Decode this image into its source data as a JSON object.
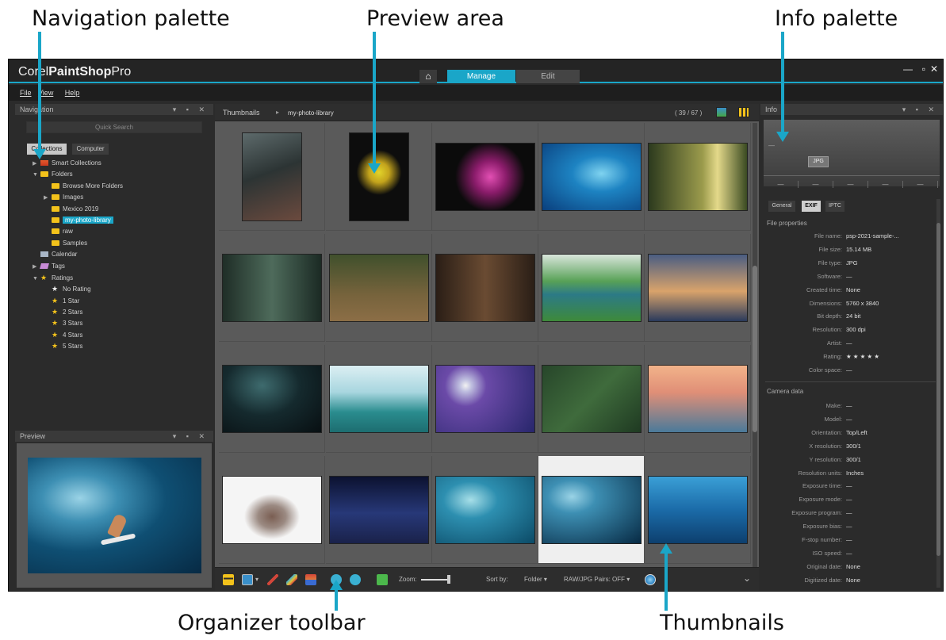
{
  "callouts": {
    "navigation": "Navigation palette",
    "preview_area": "Preview area",
    "info": "Info palette",
    "toolbar": "Organizer toolbar",
    "thumbnails": "Thumbnails"
  },
  "app": {
    "brand": "Corel",
    "product": "PaintShop",
    "suffix": "Pro",
    "home_glyph": "⌂",
    "tabs": {
      "manage": "Manage",
      "edit": "Edit"
    },
    "window_controls": [
      "—",
      "▫",
      "✕"
    ]
  },
  "menu": [
    "File",
    "View",
    "Help"
  ],
  "navigation": {
    "title": "Navigation",
    "quick_search_placeholder": "Quick Search",
    "tabs": {
      "collections": "Collections",
      "computer": "Computer"
    },
    "tree": [
      {
        "label": "Smart Collections",
        "depth": 0,
        "expander": "▶",
        "icon": "smart"
      },
      {
        "label": "Folders",
        "depth": 0,
        "expander": "▼",
        "icon": "folder"
      },
      {
        "label": "Browse More Folders",
        "depth": 1,
        "expander": "",
        "icon": "folder"
      },
      {
        "label": "Images",
        "depth": 1,
        "expander": "▶",
        "icon": "folder"
      },
      {
        "label": "Mexico 2019",
        "depth": 1,
        "expander": "",
        "icon": "folder"
      },
      {
        "label": "my-photo-library",
        "depth": 1,
        "expander": "",
        "icon": "folder",
        "selected": true
      },
      {
        "label": "raw",
        "depth": 1,
        "expander": "",
        "icon": "folder"
      },
      {
        "label": "Samples",
        "depth": 1,
        "expander": "",
        "icon": "folder"
      },
      {
        "label": "Calendar",
        "depth": 0,
        "expander": "",
        "icon": "cal"
      },
      {
        "label": "Tags",
        "depth": 0,
        "expander": "▶",
        "icon": "tag"
      },
      {
        "label": "Ratings",
        "depth": 0,
        "expander": "▼",
        "icon": "star"
      },
      {
        "label": "No Rating",
        "depth": 1,
        "expander": "",
        "icon": "star-white"
      },
      {
        "label": "1 Star",
        "depth": 1,
        "expander": "",
        "icon": "star"
      },
      {
        "label": "2 Stars",
        "depth": 1,
        "expander": "",
        "icon": "star"
      },
      {
        "label": "3 Stars",
        "depth": 1,
        "expander": "",
        "icon": "star"
      },
      {
        "label": "4 Stars",
        "depth": 1,
        "expander": "",
        "icon": "star"
      },
      {
        "label": "5 Stars",
        "depth": 1,
        "expander": "",
        "icon": "star"
      }
    ]
  },
  "preview": {
    "title": "Preview"
  },
  "palette_controls": "▾ ▪ ✕",
  "browser": {
    "crumb_root": "Thumbnails",
    "crumb_sep": "▸",
    "crumb_folder": "my-photo-library",
    "count": "( 39 / 67 )",
    "thumbnails": [
      {
        "name": "forest-light",
        "orient": "portrait",
        "bg": "linear-gradient(160deg,#5d6a6b 0%,#2c3434 45%,#6b4a3e 100%)"
      },
      {
        "name": "seahorse",
        "orient": "portrait",
        "bg": "radial-gradient(circle at 50% 45%,#e2d42a 0%,#c3a31c 18%,#0d0d0d 40%)"
      },
      {
        "name": "lionfish",
        "orient": "landscape",
        "bg": "radial-gradient(circle at 55% 50%,#e24fb3 0%,#8b1c6b 25%,#0b0b0b 55%)"
      },
      {
        "name": "manta-ray",
        "orient": "landscape",
        "bg": "radial-gradient(ellipse at 60% 45%,#7fd3f0 0%,#1d83c2 35%,#0a3f7d 100%)"
      },
      {
        "name": "sunlit-woods",
        "orient": "landscape",
        "bg": "linear-gradient(90deg,#2c3a1e 0%,#9b9b4c 55%,#e4d98a 70%,#3a4a22 100%)"
      },
      {
        "name": "misty-forest",
        "orient": "landscape",
        "bg": "linear-gradient(90deg,#1f2e27 0%,#4e6b5b 50%,#1b2a24 100%)"
      },
      {
        "name": "forest-path",
        "orient": "landscape",
        "bg": "linear-gradient(180deg,#40502c 0%,#76633c 60%,#8c6e46 100%)"
      },
      {
        "name": "dark-trees",
        "orient": "landscape",
        "bg": "linear-gradient(90deg,#2a1e16 0%,#6a4b32 50%,#2a1e16 100%)"
      },
      {
        "name": "river-valley",
        "orient": "landscape",
        "bg": "linear-gradient(180deg,#d9e6dc 0%,#58a157 40%,#2c7a86 60%,#3e8a3a 100%)"
      },
      {
        "name": "city-skyline",
        "orient": "landscape",
        "bg": "linear-gradient(180deg,#4a5d82 0%,#d9a36b 55%,#2a3a5c 100%)"
      },
      {
        "name": "night-alley",
        "orient": "landscape",
        "bg": "radial-gradient(ellipse at 40% 30%,#3e6b6e 0%,#152a2e 45%,#080f12 100%)"
      },
      {
        "name": "iceberg-boat",
        "orient": "landscape",
        "bg": "linear-gradient(180deg,#dceff3 0%,#a8d6df 40%,#2a8c8e 70%,#1d6d70 100%)"
      },
      {
        "name": "moon-clouds",
        "orient": "landscape",
        "bg": "radial-gradient(circle at 30% 30%,#f2f2f2 0%,#c0c0e0 7%,#6b4aa8 25%,#27266b 100%)"
      },
      {
        "name": "aerial-forest",
        "orient": "landscape",
        "bg": "linear-gradient(135deg,#27462a 0%,#3f6b3c 50%,#1f3a22 100%)"
      },
      {
        "name": "foggy-city",
        "orient": "landscape",
        "bg": "linear-gradient(180deg,#f2b38a 0%,#e08f77 40%,#4a7a9a 100%)"
      },
      {
        "name": "photographer",
        "orient": "landscape",
        "bg": "radial-gradient(ellipse at 50% 60%,#7a5e52 0%,#9b8a82 20%,#f5f5f5 40%)"
      },
      {
        "name": "astronaut-stars",
        "orient": "landscape",
        "bg": "linear-gradient(180deg,#0c1230 0%,#273878 55%,#1a224a 100%)"
      },
      {
        "name": "surf-tube",
        "orient": "landscape",
        "bg": "radial-gradient(ellipse at 35% 35%,#a7dfe8 0%,#2d8fb0 30%,#0b4a66 100%)"
      },
      {
        "name": "surfer-underwater",
        "orient": "landscape",
        "bg": "radial-gradient(ellipse at 30% 30%,#9ad3e6 0%,#3d8fb3 25%,#072a44 100%)",
        "selected": true
      },
      {
        "name": "dolphins",
        "orient": "landscape",
        "bg": "linear-gradient(180deg,#3a9fd6 0%,#1b6ba8 50%,#0d3f6e 100%)"
      }
    ]
  },
  "toolbar": {
    "zoom_label": "Zoom:",
    "sort_label": "Sort by:",
    "sort_value": "Folder ▾",
    "raw_pairs": "RAW/JPG Pairs: OFF ▾",
    "collapse": "⌄",
    "icons": [
      "filmstrip-icon",
      "layout-icon",
      "brush-red-icon",
      "brush-multi-icon",
      "share-icon",
      "rotate-left-icon",
      "rotate-right-icon",
      "compare-icon",
      "globe-icon"
    ]
  },
  "info": {
    "title": "Info",
    "preview_dash": "—",
    "format_badge": "JPG",
    "slots": [
      "—",
      "—",
      "—",
      "—",
      "—"
    ],
    "tabs": {
      "general": "General",
      "exif": "EXIF",
      "iptc": "IPTC"
    },
    "file_properties_title": "File properties",
    "file_properties": [
      {
        "k": "File name:",
        "v": "psp-2021-sample-..."
      },
      {
        "k": "File size:",
        "v": "15.14 MB"
      },
      {
        "k": "File type:",
        "v": "JPG"
      },
      {
        "k": "Software:",
        "v": "—"
      },
      {
        "k": "Created time:",
        "v": "None"
      },
      {
        "k": "Dimensions:",
        "v": "5760 x 3840"
      },
      {
        "k": "Bit depth:",
        "v": "24 bit"
      },
      {
        "k": "Resolution:",
        "v": "300 dpi"
      },
      {
        "k": "Artist:",
        "v": "—"
      },
      {
        "k": "Rating:",
        "v": "★ ★ ★ ★ ★"
      },
      {
        "k": "Color space:",
        "v": "—"
      }
    ],
    "camera_data_title": "Camera data",
    "camera_data": [
      {
        "k": "Make:",
        "v": "—"
      },
      {
        "k": "Model:",
        "v": "—"
      },
      {
        "k": "Orientation:",
        "v": "Top/Left"
      },
      {
        "k": "X resolution:",
        "v": "300/1"
      },
      {
        "k": "Y resolution:",
        "v": "300/1"
      },
      {
        "k": "Resolution units:",
        "v": "Inches"
      },
      {
        "k": "Exposure time:",
        "v": "—"
      },
      {
        "k": "Exposure mode:",
        "v": "—"
      },
      {
        "k": "Exposure program:",
        "v": "—"
      },
      {
        "k": "Exposure bias:",
        "v": "—"
      },
      {
        "k": "F-stop number:",
        "v": "—"
      },
      {
        "k": "ISO speed:",
        "v": "—"
      },
      {
        "k": "Original date:",
        "v": "None"
      },
      {
        "k": "Digitized date:",
        "v": "None"
      }
    ]
  },
  "colors": {
    "accent": "#1aa6c8",
    "panel": "#2b2b2b",
    "grid": "#5a5a5a",
    "star": "#f3c21b"
  }
}
